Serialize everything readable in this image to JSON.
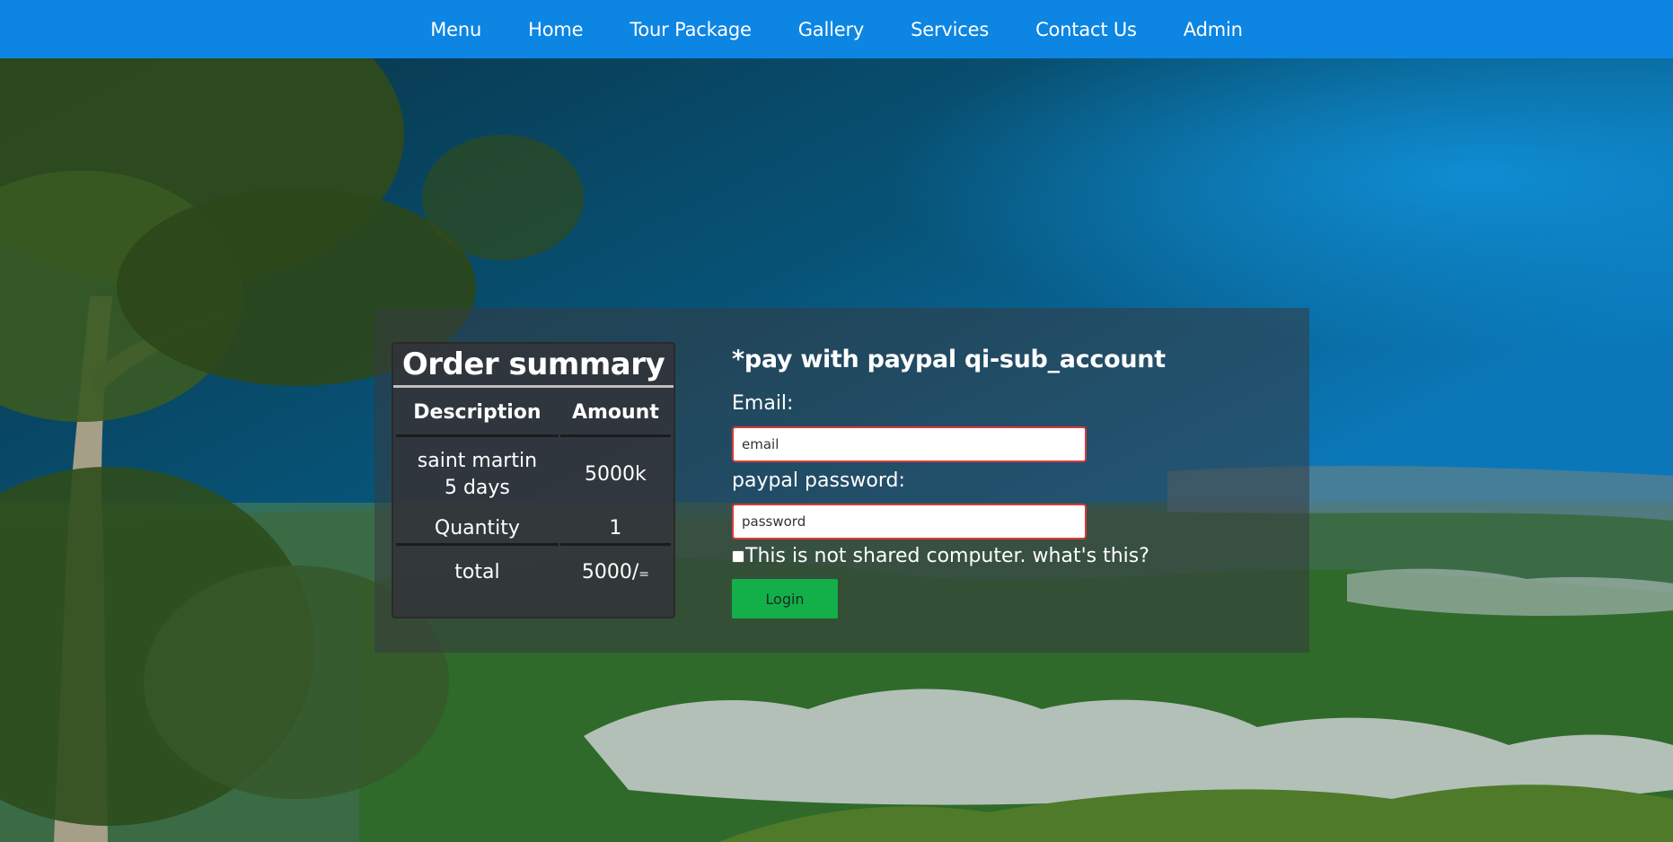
{
  "nav": {
    "items": [
      {
        "label": "Menu"
      },
      {
        "label": "Home"
      },
      {
        "label": "Tour Package"
      },
      {
        "label": "Gallery"
      },
      {
        "label": "Services"
      },
      {
        "label": "Contact Us"
      },
      {
        "label": "Admin"
      }
    ],
    "background_color": "#0c85e3"
  },
  "order_summary": {
    "title": "Order summary",
    "headers": {
      "description": "Description",
      "amount": "Amount"
    },
    "item": {
      "description_line1": "saint martin",
      "description_line2": "5 days",
      "amount": "5000k"
    },
    "quantity": {
      "label": "Quantity",
      "value": "1"
    },
    "total": {
      "label": "total",
      "amount": "5000/",
      "suffix": "="
    }
  },
  "login_form": {
    "title": "*pay with paypal qi-sub_account",
    "email_label": "Email:",
    "email_placeholder": "email",
    "password_label": "paypal password:",
    "password_placeholder": "password",
    "remember_text": "This is not shared computer. what's this?",
    "login_label": "Login",
    "button_color": "#13b04a",
    "input_border_color": "#d83a3a"
  }
}
